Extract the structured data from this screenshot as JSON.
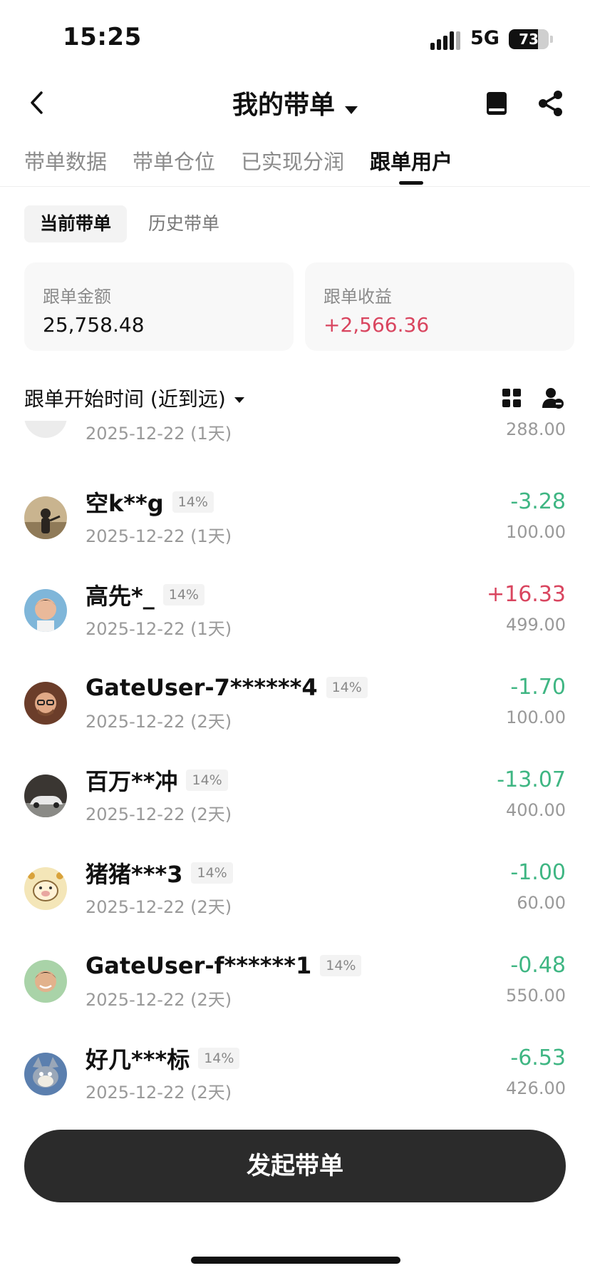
{
  "status_bar": {
    "time": "15:25",
    "network": "5G",
    "battery": "73",
    "battery_level": 0.73
  },
  "header": {
    "title": "我的带单",
    "icons": [
      "back-arrow-icon",
      "caret-down-icon",
      "book-icon",
      "share-icon"
    ]
  },
  "tabs": [
    {
      "label": "带单数据",
      "active": false
    },
    {
      "label": "带单仓位",
      "active": false
    },
    {
      "label": "已实现分润",
      "active": false
    },
    {
      "label": "跟单用户",
      "active": true
    }
  ],
  "sub_tabs": [
    {
      "label": "当前带单",
      "active": true
    },
    {
      "label": "历史带单",
      "active": false
    }
  ],
  "stats": {
    "amount_label": "跟单金额",
    "amount_value": "25,758.48",
    "profit_label": "跟单收益",
    "profit_value": "+2,566.36"
  },
  "sort": {
    "label": "跟单开始时间 (近到远)"
  },
  "list": {
    "partial_row": {
      "date": "2025-12-22 (1天)",
      "amount": "288.00"
    },
    "rows": [
      {
        "name": "空k**g",
        "ratio": "14%",
        "date": "2025-12-22 (1天)",
        "pnl": "-3.28",
        "amount": "100.00"
      },
      {
        "name": "高先*_",
        "ratio": "14%",
        "date": "2025-12-22 (1天)",
        "pnl": "+16.33",
        "amount": "499.00"
      },
      {
        "name": "GateUser-7******4",
        "ratio": "14%",
        "date": "2025-12-22 (2天)",
        "pnl": "-1.70",
        "amount": "100.00"
      },
      {
        "name": "百万**冲",
        "ratio": "14%",
        "date": "2025-12-22 (2天)",
        "pnl": "-13.07",
        "amount": "400.00"
      },
      {
        "name": "猪猪***3",
        "ratio": "14%",
        "date": "2025-12-22 (2天)",
        "pnl": "-1.00",
        "amount": "60.00"
      },
      {
        "name": "GateUser-f******1",
        "ratio": "14%",
        "date": "2025-12-22 (2天)",
        "pnl": "-0.48",
        "amount": "550.00"
      },
      {
        "name": "好几***标",
        "ratio": "14%",
        "date": "2025-12-22 (2天)",
        "pnl": "-6.53",
        "amount": "426.00"
      }
    ]
  },
  "cta": {
    "label": "发起带单"
  },
  "colors": {
    "positive": "#d9455f",
    "negative": "#3fb683",
    "button": "#2b2b2b"
  }
}
